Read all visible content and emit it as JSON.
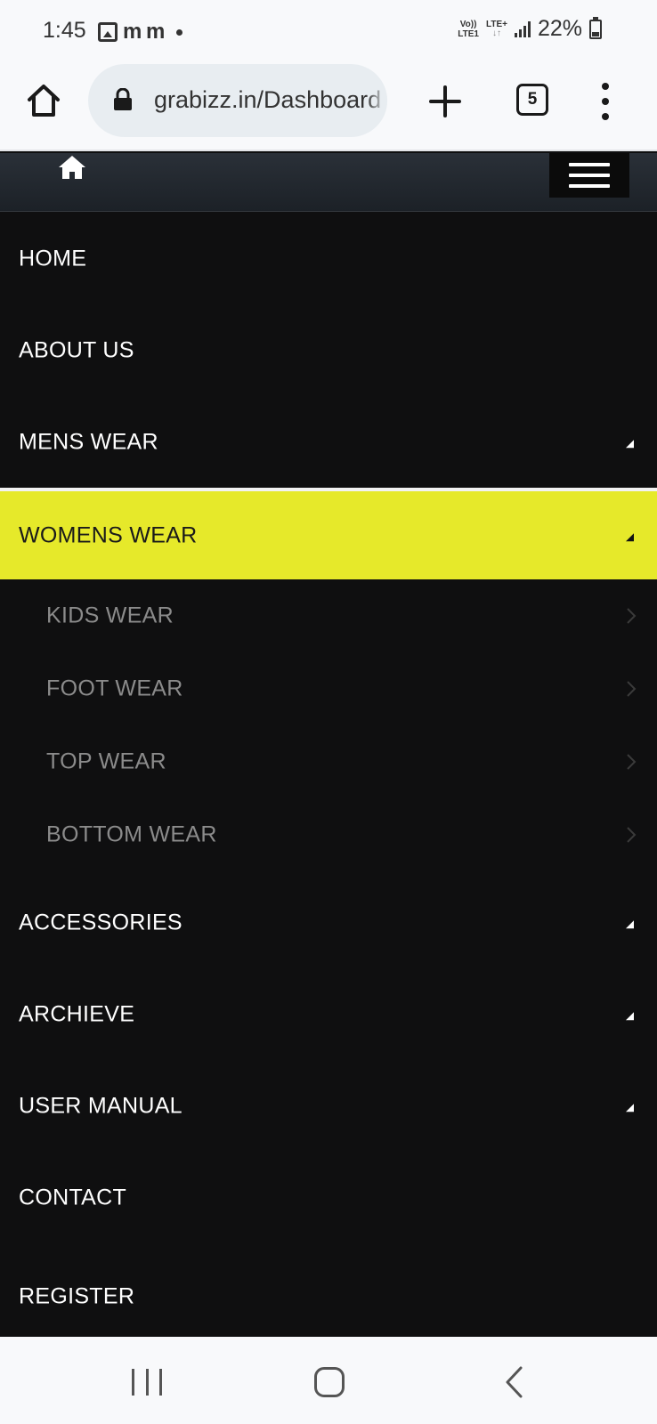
{
  "status_bar": {
    "time": "1:45",
    "notif_letters": "m m",
    "volte_top": "Vo))",
    "volte_bottom": "LTE1",
    "lte_label": "LTE+",
    "lte_arrows": "↓↑",
    "battery": "22%"
  },
  "browser": {
    "url": "grabizz.in/Dashboard",
    "tab_count": "5",
    "icons": [
      "home-icon",
      "lock-icon",
      "plus-icon",
      "tabs-icon",
      "more-vert-icon"
    ]
  },
  "site_header": {
    "icons": [
      "home-icon",
      "hamburger-menu-icon"
    ]
  },
  "nav": {
    "items": [
      {
        "label": "HOME"
      },
      {
        "label": "ABOUT US"
      },
      {
        "label": "MENS WEAR",
        "has_submenu": true
      },
      {
        "label": "WOMENS WEAR",
        "has_submenu": true,
        "active": true
      }
    ],
    "womens_submenu": [
      {
        "label": "KIDS WEAR"
      },
      {
        "label": "FOOT WEAR"
      },
      {
        "label": "TOP WEAR"
      },
      {
        "label": "BOTTOM WEAR"
      }
    ],
    "items_after": [
      {
        "label": "ACCESSORIES",
        "has_submenu": true
      },
      {
        "label": "ARCHIEVE",
        "has_submenu": true
      },
      {
        "label": "USER MANUAL",
        "has_submenu": true
      },
      {
        "label": "CONTACT"
      },
      {
        "label": "REGISTER"
      }
    ]
  },
  "colors": {
    "menu_background": "#0f0f10",
    "active_highlight": "#e6e92a",
    "submenu_text": "#8b8b8b",
    "header_background": "#22272e"
  }
}
